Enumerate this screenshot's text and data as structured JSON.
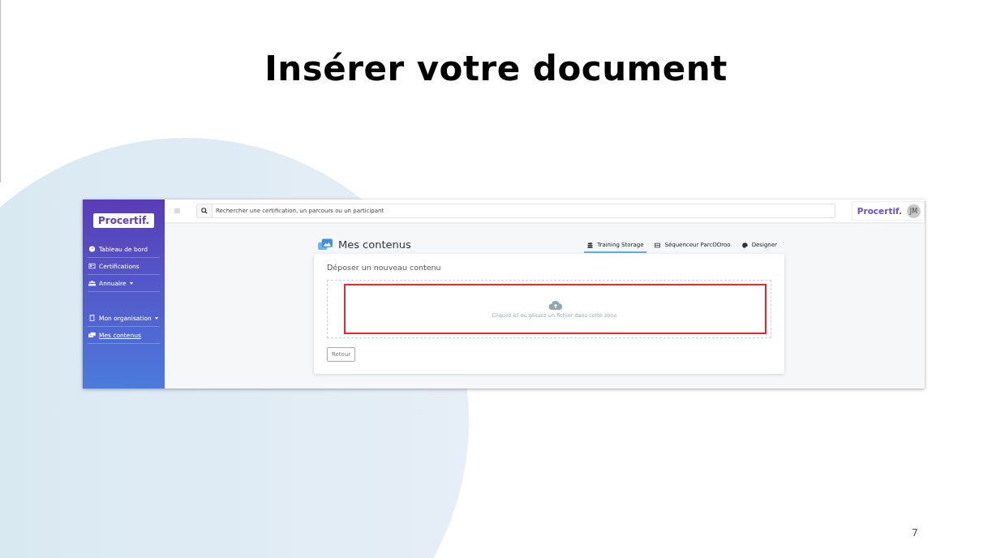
{
  "slide": {
    "title": "Insérer votre document",
    "page_number": "7"
  },
  "app": {
    "sidebar": {
      "logo": "Procertif.",
      "sections": [
        {
          "items": [
            {
              "label": "Tableau de bord",
              "selected": false,
              "expandable": false
            },
            {
              "label": "Certifications",
              "selected": false,
              "expandable": false
            },
            {
              "label": "Annuaire",
              "selected": false,
              "expandable": true
            }
          ]
        },
        {
          "items": [
            {
              "label": "Mon organisation",
              "selected": false,
              "expandable": true
            },
            {
              "label": "Mes contenus",
              "selected": true,
              "expandable": false
            }
          ]
        }
      ]
    },
    "topbar": {
      "search_placeholder": "Rechercher une certification, un parcours ou un participant",
      "brand": "Procertif.",
      "avatar_initials": "JM"
    },
    "page_title": "Mes contenus",
    "tabs": [
      {
        "label": "Training Storage",
        "selected": true
      },
      {
        "label": "Séquenceur ParcOOroo",
        "selected": false
      },
      {
        "label": "Designer",
        "selected": false
      }
    ],
    "card": {
      "title": "Déposer un nouveau contenu",
      "dropzone_text": "Cliquez ici ou glissez un fichier dans cette zone.",
      "highlighted": true,
      "back_button": "Retour"
    }
  }
}
